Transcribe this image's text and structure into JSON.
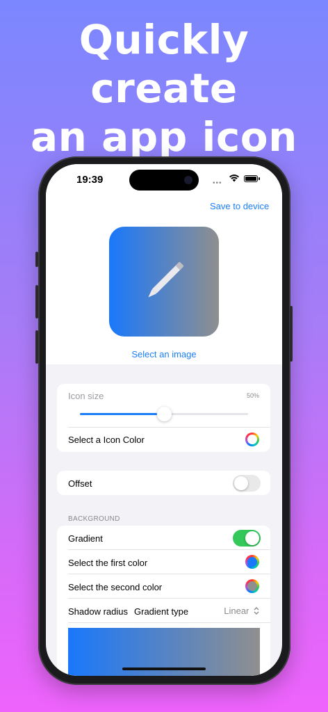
{
  "headline": {
    "line1": "Quickly create",
    "line2": "an app icon"
  },
  "status_bar": {
    "time": "19:39",
    "dots": "•••"
  },
  "toolbar": {
    "save_label": "Save to device"
  },
  "preview": {
    "select_image_label": "Select an image",
    "gradient_start": "#1a78fb",
    "gradient_end": "#8f8f8f"
  },
  "icon_settings": {
    "icon_size_label": "Icon size",
    "icon_size_value": "50%",
    "icon_size_fraction": 0.5,
    "icon_color_label": "Select a Icon Color"
  },
  "offset": {
    "label": "Offset",
    "enabled": false
  },
  "background": {
    "section_title": "BACKGROUND",
    "gradient_label": "Gradient",
    "gradient_enabled": true,
    "first_color_label": "Select the first color",
    "first_color": "#1a78fb",
    "second_color_label": "Select the second color",
    "second_color": "#8f8f8f",
    "shadow_radius_label": "Shadow radius",
    "gradient_type_label": "Gradient type",
    "gradient_type_value": "Linear"
  },
  "colors": {
    "accent": "#1a7ef8",
    "toggle_on": "#34c759"
  }
}
